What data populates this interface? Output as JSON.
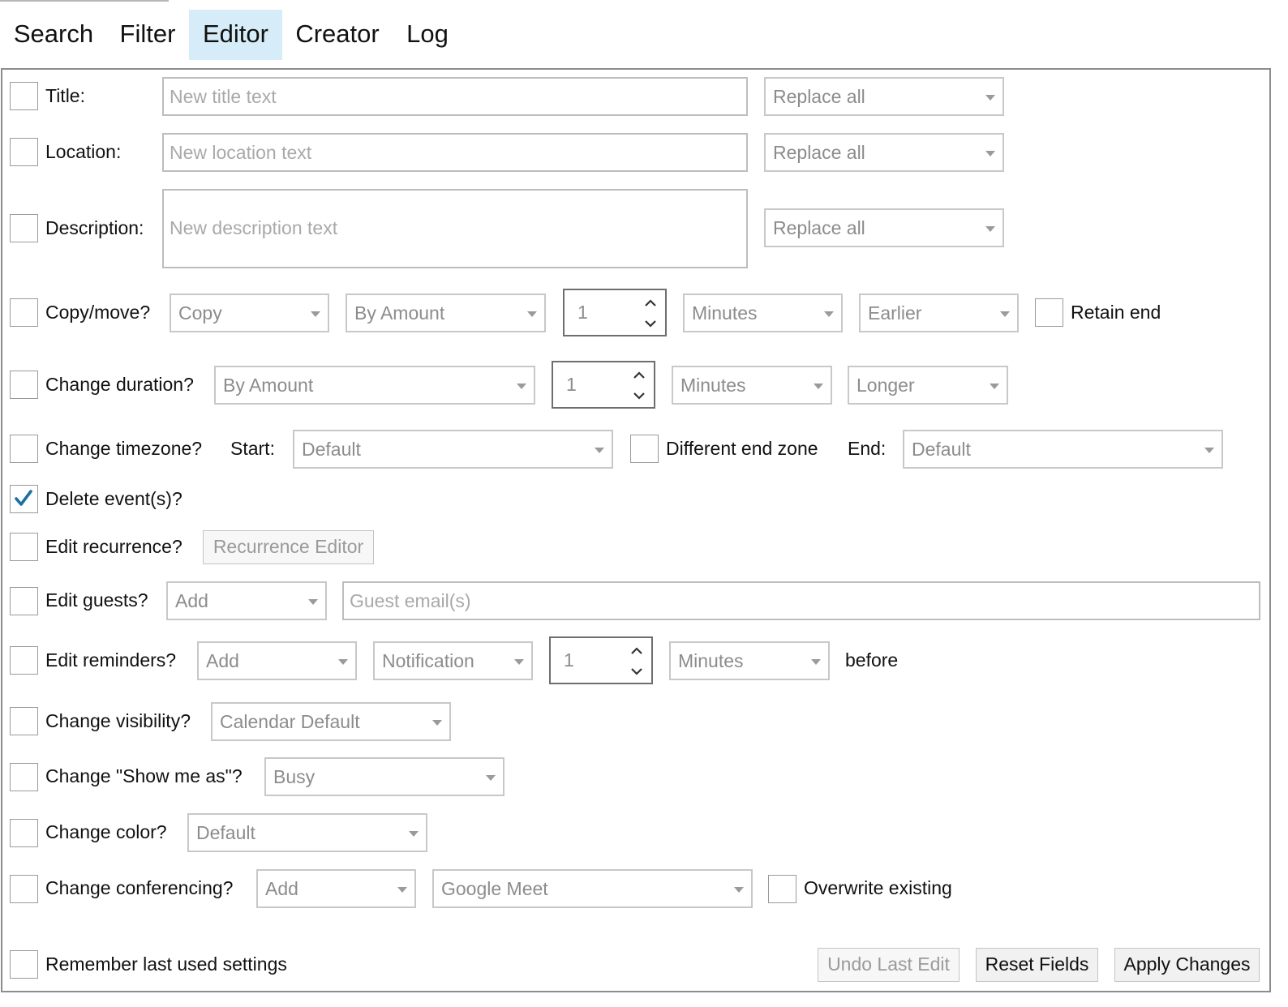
{
  "tabs": [
    {
      "label": "Search"
    },
    {
      "label": "Filter"
    },
    {
      "label": "Editor"
    },
    {
      "label": "Creator"
    },
    {
      "label": "Log"
    }
  ],
  "active_tab": "Editor",
  "fields": {
    "title": {
      "label": "Title:",
      "placeholder": "New title text",
      "mode": "Replace all"
    },
    "location": {
      "label": "Location:",
      "placeholder": "New location text",
      "mode": "Replace all"
    },
    "description": {
      "label": "Description:",
      "placeholder": "New description text",
      "mode": "Replace all"
    }
  },
  "copy_move": {
    "label": "Copy/move?",
    "action": "Copy",
    "method": "By Amount",
    "amount": "1",
    "unit": "Minutes",
    "direction": "Earlier",
    "retain_end_label": "Retain end"
  },
  "duration": {
    "label": "Change duration?",
    "method": "By Amount",
    "amount": "1",
    "unit": "Minutes",
    "direction": "Longer"
  },
  "timezone": {
    "label": "Change timezone?",
    "start_label": "Start:",
    "start_value": "Default",
    "different_end_label": "Different end zone",
    "end_label": "End:",
    "end_value": "Default"
  },
  "delete": {
    "label": "Delete event(s)?",
    "checked": true
  },
  "recurrence": {
    "label": "Edit recurrence?",
    "button": "Recurrence Editor"
  },
  "guests": {
    "label": "Edit guests?",
    "action": "Add",
    "placeholder": "Guest email(s)"
  },
  "reminders": {
    "label": "Edit reminders?",
    "action": "Add",
    "type": "Notification",
    "amount": "1",
    "unit": "Minutes",
    "suffix": "before"
  },
  "visibility": {
    "label": "Change visibility?",
    "value": "Calendar Default"
  },
  "show_me_as": {
    "label": "Change \"Show me as\"?",
    "value": "Busy"
  },
  "color": {
    "label": "Change color?",
    "value": "Default"
  },
  "conferencing": {
    "label": "Change conferencing?",
    "action": "Add",
    "type": "Google Meet",
    "overwrite_label": "Overwrite existing"
  },
  "footer": {
    "remember_label": "Remember last used settings",
    "undo": "Undo Last Edit",
    "reset": "Reset Fields",
    "apply": "Apply Changes"
  },
  "colors": {
    "active_tab_bg": "#d6ecf8",
    "check_color": "#1a6fa3",
    "panel_border": "#8c8c8c"
  }
}
